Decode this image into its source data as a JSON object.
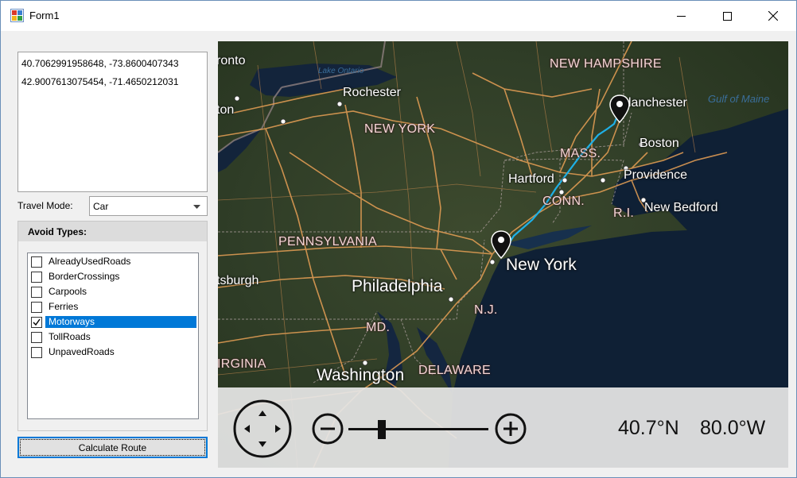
{
  "window": {
    "title": "Form1",
    "minimize_icon": "minimize-icon",
    "maximize_icon": "maximize-icon",
    "close_icon": "close-icon"
  },
  "waypoints": [
    "40.7062991958648, -73.8600407343",
    "42.9007613075454, -71.4650212031"
  ],
  "travel_mode": {
    "label": "Travel Mode:",
    "value": "Car"
  },
  "avoid_types": {
    "title": "Avoid Types:",
    "items": [
      {
        "label": "AlreadyUsedRoads",
        "checked": false,
        "selected": false
      },
      {
        "label": "BorderCrossings",
        "checked": false,
        "selected": false
      },
      {
        "label": "Carpools",
        "checked": false,
        "selected": false
      },
      {
        "label": "Ferries",
        "checked": false,
        "selected": false
      },
      {
        "label": "Motorways",
        "checked": true,
        "selected": true
      },
      {
        "label": "TollRoads",
        "checked": false,
        "selected": false
      },
      {
        "label": "UnpavedRoads",
        "checked": false,
        "selected": false
      }
    ]
  },
  "calculate_button": {
    "label": "Calculate Route"
  },
  "map": {
    "route_color": "#1fb0e6",
    "labels": {
      "toronto": "ronto",
      "lake_ontario": "Lake Ontario",
      "rochester": "Rochester",
      "new_hampshire": "NEW HAMPSHIRE",
      "manchester": "lanchester",
      "gulf_of_maine": "Gulf of Maine",
      "new_york_state": "NEW YORK",
      "boston": "Boston",
      "mass": "MASS.",
      "hartford": "Hartford",
      "providence": "Providence",
      "conn": "CONN.",
      "ri": "R.I.",
      "new_bedford": "New Bedford",
      "pennsylvania": "PENNSYLVANIA",
      "new_york_city": "New York",
      "pittsburgh": "tsburgh",
      "philadelphia": "Philadelphia",
      "nj": "N.J.",
      "md": "MD.",
      "virginia": "IRGINIA",
      "washington": "Washington",
      "delaware": "DELAWARE",
      "ton": "ton"
    },
    "navigation": {
      "latitude": "40.7°N",
      "longitude": "80.0°W",
      "zoom_level": 0.24
    }
  }
}
